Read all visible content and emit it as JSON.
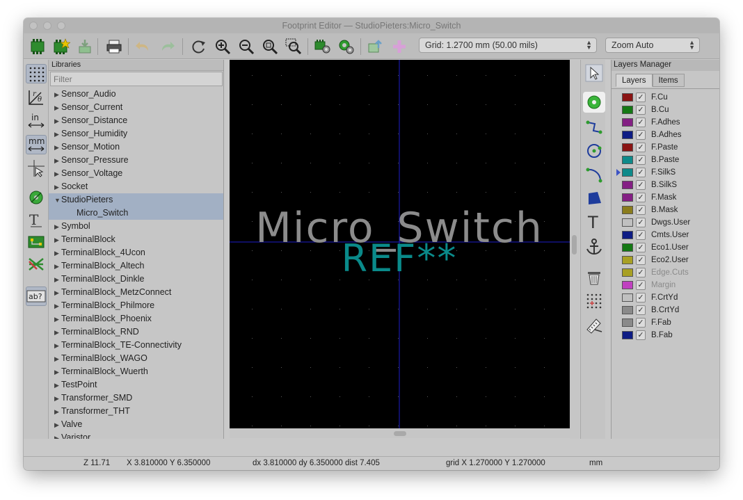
{
  "window": {
    "title": "Footprint Editor — StudioPieters:Micro_Switch"
  },
  "toolbar": {
    "grid_select": "Grid: 1.2700 mm (50.00 mils)",
    "zoom_select": "Zoom Auto"
  },
  "libraries": {
    "header": "Libraries",
    "filter_placeholder": "Filter",
    "items": [
      {
        "label": "Sensor_Audio",
        "tri": "▶"
      },
      {
        "label": "Sensor_Current",
        "tri": "▶"
      },
      {
        "label": "Sensor_Distance",
        "tri": "▶"
      },
      {
        "label": "Sensor_Humidity",
        "tri": "▶"
      },
      {
        "label": "Sensor_Motion",
        "tri": "▶"
      },
      {
        "label": "Sensor_Pressure",
        "tri": "▶"
      },
      {
        "label": "Sensor_Voltage",
        "tri": "▶"
      },
      {
        "label": "Socket",
        "tri": "▶"
      },
      {
        "label": "StudioPieters",
        "tri": "▼"
      },
      {
        "label": "Micro_Switch",
        "tri": ""
      },
      {
        "label": "Symbol",
        "tri": "▶"
      },
      {
        "label": "TerminalBlock",
        "tri": "▶"
      },
      {
        "label": "TerminalBlock_4Ucon",
        "tri": "▶"
      },
      {
        "label": "TerminalBlock_Altech",
        "tri": "▶"
      },
      {
        "label": "TerminalBlock_Dinkle",
        "tri": "▶"
      },
      {
        "label": "TerminalBlock_MetzConnect",
        "tri": "▶"
      },
      {
        "label": "TerminalBlock_Philmore",
        "tri": "▶"
      },
      {
        "label": "TerminalBlock_Phoenix",
        "tri": "▶"
      },
      {
        "label": "TerminalBlock_RND",
        "tri": "▶"
      },
      {
        "label": "TerminalBlock_TE-Connectivity",
        "tri": "▶"
      },
      {
        "label": "TerminalBlock_WAGO",
        "tri": "▶"
      },
      {
        "label": "TerminalBlock_Wuerth",
        "tri": "▶"
      },
      {
        "label": "TestPoint",
        "tri": "▶"
      },
      {
        "label": "Transformer_SMD",
        "tri": "▶"
      },
      {
        "label": "Transformer_THT",
        "tri": "▶"
      },
      {
        "label": "Valve",
        "tri": "▶"
      },
      {
        "label": "Varistor",
        "tri": "▶"
      }
    ]
  },
  "canvas": {
    "value_text": "Micro_Switch",
    "reference_text": "REF**",
    "value_color": "#8c8c8c",
    "reference_color": "#0a8a8a"
  },
  "layers_manager": {
    "header": "Layers Manager",
    "tabs": [
      "Layers",
      "Items"
    ],
    "layers": [
      {
        "name": "F.Cu",
        "color": "#8a1414",
        "check": "✓"
      },
      {
        "name": "B.Cu",
        "color": "#147814",
        "check": "✓"
      },
      {
        "name": "F.Adhes",
        "color": "#841f84",
        "check": "✓"
      },
      {
        "name": "B.Adhes",
        "color": "#0e1c84",
        "check": "✓"
      },
      {
        "name": "F.Paste",
        "color": "#8a1414",
        "check": "✓"
      },
      {
        "name": "B.Paste",
        "color": "#0e8a8a",
        "check": "✓"
      },
      {
        "name": "F.SilkS",
        "color": "#0e8a8a",
        "check": "✓",
        "active": true
      },
      {
        "name": "B.SilkS",
        "color": "#841f84",
        "check": "✓"
      },
      {
        "name": "F.Mask",
        "color": "#841f84",
        "check": "✓"
      },
      {
        "name": "B.Mask",
        "color": "#8a7c1c",
        "check": "✓"
      },
      {
        "name": "Dwgs.User",
        "color": "#c0c0c0",
        "check": "✓"
      },
      {
        "name": "Cmts.User",
        "color": "#0e1c84",
        "check": "✓"
      },
      {
        "name": "Eco1.User",
        "color": "#147814",
        "check": "✓"
      },
      {
        "name": "Eco2.User",
        "color": "#a8a024",
        "check": "✓"
      },
      {
        "name": "Edge.Cuts",
        "color": "#a8a024",
        "check": "✓",
        "dim": true
      },
      {
        "name": "Margin",
        "color": "#c040c0",
        "check": "✓",
        "dim": true
      },
      {
        "name": "F.CrtYd",
        "color": "#c0c0c0",
        "check": "✓"
      },
      {
        "name": "B.CrtYd",
        "color": "#8a8a8a",
        "check": "✓"
      },
      {
        "name": "F.Fab",
        "color": "#8a8a8a",
        "check": "✓"
      },
      {
        "name": "B.Fab",
        "color": "#0e1c84",
        "check": "✓"
      }
    ]
  },
  "status": {
    "zoom": "Z 11.71",
    "xy": "X 3.810000  Y 6.350000",
    "delta": "dx 3.810000  dy 6.350000  dist 7.405",
    "grid": "grid X 1.270000  Y 1.270000",
    "units": "mm"
  },
  "icons": [
    "new-footprint-icon",
    "library-star-icon",
    "import-icon",
    "print-icon",
    "undo-icon",
    "redo-icon",
    "refresh-icon",
    "zoom-in-icon",
    "zoom-out-icon",
    "zoom-fit-icon",
    "zoom-selection-icon",
    "pad-settings-icon",
    "footprint-settings-icon",
    "load-from-board-icon",
    "insert-board-icon",
    "grid-dots-icon",
    "polar-coords-icon",
    "inch-units-icon",
    "mm-units-icon",
    "cursor-crosshair-icon",
    "pad-icon",
    "text-icon",
    "show-pads-icon",
    "ratsnest-icon",
    "ab-text-icon",
    "select-arrow-icon",
    "add-pad-icon",
    "line-icon",
    "circle-icon",
    "arc-icon",
    "polygon-icon",
    "text-tool-icon",
    "anchor-icon",
    "delete-icon",
    "grid-origin-icon",
    "measure-icon"
  ]
}
